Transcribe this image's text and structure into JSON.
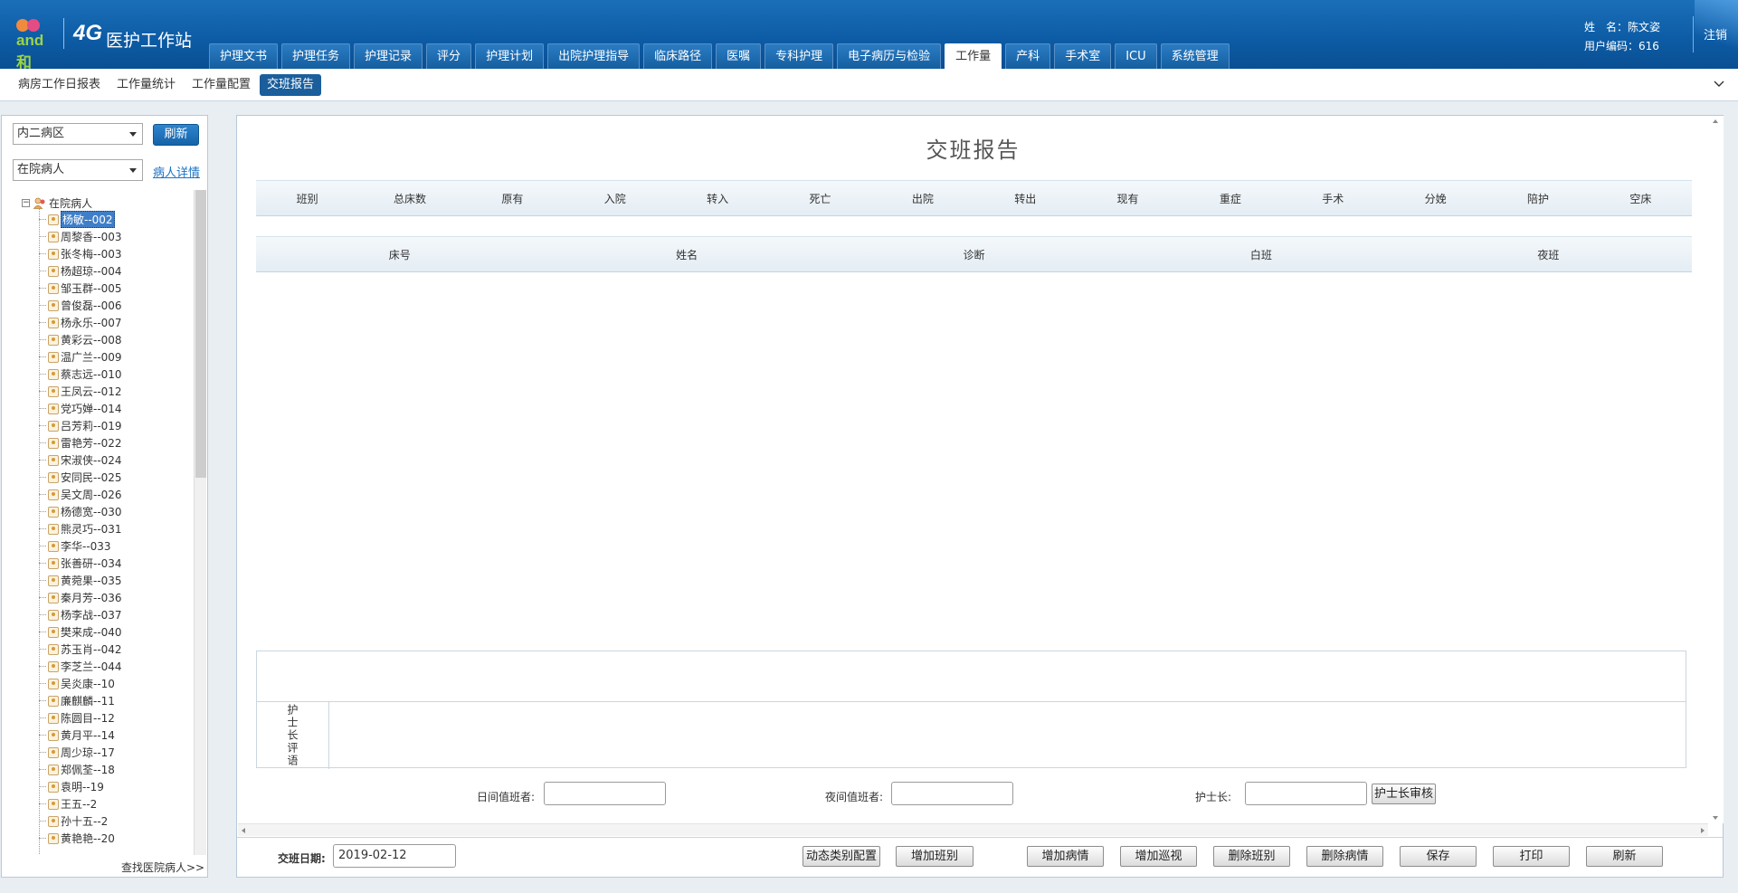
{
  "header": {
    "logo_text": "and和",
    "logo_4g": "4G",
    "app_title": "医护工作站",
    "nav_tabs": [
      {
        "label": "护理文书",
        "active": false
      },
      {
        "label": "护理任务",
        "active": false
      },
      {
        "label": "护理记录",
        "active": false
      },
      {
        "label": "评分",
        "active": false
      },
      {
        "label": "护理计划",
        "active": false
      },
      {
        "label": "出院护理指导",
        "active": false
      },
      {
        "label": "临床路径",
        "active": false
      },
      {
        "label": "医嘱",
        "active": false
      },
      {
        "label": "专科护理",
        "active": false
      },
      {
        "label": "电子病历与检验",
        "active": false
      },
      {
        "label": "工作量",
        "active": true
      },
      {
        "label": "产科",
        "active": false
      },
      {
        "label": "手术室",
        "active": false
      },
      {
        "label": "ICU",
        "active": false
      },
      {
        "label": "系统管理",
        "active": false
      }
    ],
    "user_name_line": "姓　名：陈文姿",
    "user_code_line": "用户编码：616",
    "logout_label": "注销"
  },
  "subnav": {
    "items": [
      {
        "label": "病房工作日报表",
        "active": false
      },
      {
        "label": "工作量统计",
        "active": false
      },
      {
        "label": "工作量配置",
        "active": false
      },
      {
        "label": "交班报告",
        "active": true
      }
    ]
  },
  "left_panel": {
    "ward_select": "内二病区",
    "refresh_label": "刷新",
    "patient_type_select": "在院病人",
    "patient_detail_link": "病人详情",
    "tree_root": "在院病人",
    "patients": [
      "杨敏--002",
      "周黎香--003",
      "张冬梅--003",
      "杨超琼--004",
      "邹玉群--005",
      "曾俊磊--006",
      "杨永乐--007",
      "黄彩云--008",
      "温广兰--009",
      "蔡志远--010",
      "王凤云--012",
      "党巧婵--014",
      "吕芳莉--019",
      "雷艳芳--022",
      "宋淑侠--024",
      "安同民--025",
      "吴文周--026",
      "杨德宽--030",
      "熊灵巧--031",
      "李华--033",
      "张善研--034",
      "黄菀果--035",
      "秦月芳--036",
      "杨李战--037",
      "樊来成--040",
      "苏玉肖--042",
      "李芝兰--044",
      "吴炎康--10",
      "廉麒麟--11",
      "陈圆目--12",
      "黄月平--14",
      "周少琼--17",
      "郑佩荃--18",
      "袁明--19",
      "王五--2",
      "孙十五--2",
      "黄艳艳--20"
    ],
    "selected_index": 0,
    "find_discharged_link": "查找医院病人>>"
  },
  "main": {
    "title": "交班报告",
    "stat_columns": [
      "班别",
      "总床数",
      "原有",
      "入院",
      "转入",
      "死亡",
      "出院",
      "转出",
      "现有",
      "重症",
      "手术",
      "分娩",
      "陪护",
      "空床"
    ],
    "patient_columns": [
      "床号",
      "姓名",
      "诊断",
      "白班",
      "夜班"
    ],
    "head_nurse_comment_label": "护士长评语",
    "day_shift_label": "日间值班者:",
    "day_shift_value": "",
    "night_shift_label": "夜间值班者:",
    "night_shift_value": "",
    "head_nurse_label": "护士长:",
    "head_nurse_value": "",
    "head_nurse_review_button": "护士长审核"
  },
  "footer": {
    "date_label": "交班日期:",
    "date_value": "2019-02-12",
    "buttons": [
      "动态类别配置",
      "增加班别",
      "增加病情",
      "增加巡视",
      "删除班别",
      "删除病情",
      "保存",
      "打印",
      "刷新"
    ]
  }
}
